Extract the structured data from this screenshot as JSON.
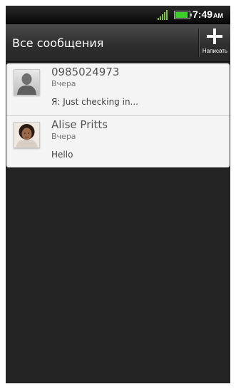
{
  "status_bar": {
    "time": "7:49",
    "ampm": "AM",
    "battery_level_percent": 90,
    "colors": {
      "signal": "#7fbf3f",
      "battery": "#3fcf2a"
    }
  },
  "header": {
    "title": "Все сообщения",
    "compose_label": "Написать"
  },
  "conversations": [
    {
      "name": "0985024973",
      "time": "Вчера",
      "preview": "Я: Just checking in..."
    },
    {
      "name": "Alise Pritts",
      "time": "Вчера",
      "preview": "Hello"
    }
  ],
  "colors": {
    "background": "#232323",
    "list_background": "#f4f4f4"
  }
}
